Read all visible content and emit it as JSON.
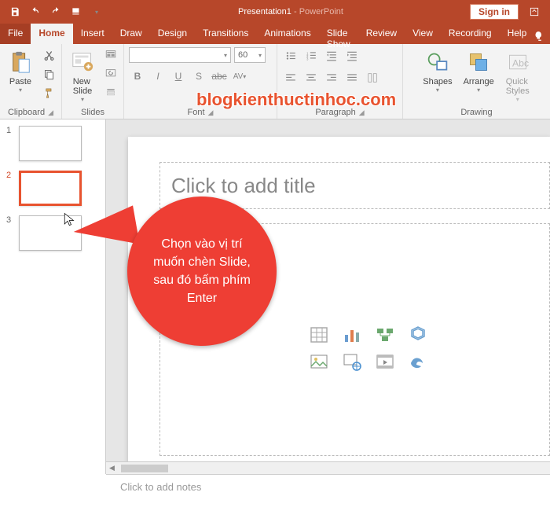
{
  "titlebar": {
    "doc_name": "Presentation1",
    "app_suffix": " - PowerPoint",
    "signin": "Sign in"
  },
  "tabs": {
    "file": "File",
    "home": "Home",
    "insert": "Insert",
    "draw": "Draw",
    "design": "Design",
    "transitions": "Transitions",
    "animations": "Animations",
    "slideshow": "Slide Show",
    "review": "Review",
    "view": "View",
    "recording": "Recording",
    "help": "Help"
  },
  "ribbon": {
    "clipboard": {
      "label": "Clipboard",
      "paste": "Paste"
    },
    "slides": {
      "label": "Slides",
      "newslide": "New\nSlide"
    },
    "font": {
      "label": "Font",
      "size": "60"
    },
    "paragraph": {
      "label": "Paragraph"
    },
    "drawing": {
      "label": "Drawing",
      "shapes": "Shapes",
      "arrange": "Arrange",
      "quickstyles": "Quick\nStyles"
    }
  },
  "thumbs": {
    "n1": "1",
    "n2": "2",
    "n3": "3"
  },
  "placeholders": {
    "title": "Click to add title"
  },
  "notes": {
    "prompt": "Click to add notes"
  },
  "callout": {
    "text": "Chọn vào vị trí muốn chèn Slide, sau đó bấm phím Enter"
  },
  "watermark": "blogkienthuctinhoc.com"
}
